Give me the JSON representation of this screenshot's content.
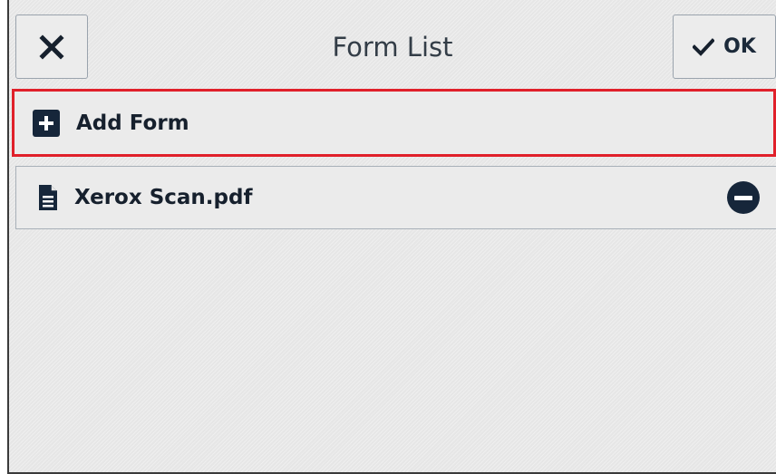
{
  "header": {
    "title": "Form List",
    "ok_label": "OK"
  },
  "list": {
    "add_label": "Add Form",
    "items": [
      {
        "label": "Xerox Scan.pdf"
      }
    ]
  },
  "colors": {
    "accent_dark": "#16263a",
    "highlight_border": "#e0202a",
    "background": "#e6e6e6"
  },
  "icons": {
    "cancel": "close-icon",
    "ok": "checkmark-icon",
    "add": "plus-square-icon",
    "file": "document-icon",
    "remove": "minus-circle-icon"
  }
}
